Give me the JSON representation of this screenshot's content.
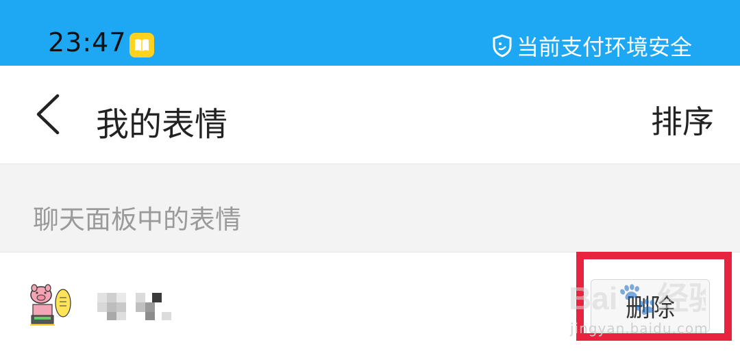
{
  "status_bar": {
    "time": "23:47",
    "notification_icon": "book-icon",
    "security_text": "当前支付环境安全",
    "background_color": "#1ea7f2"
  },
  "nav": {
    "back_icon": "chevron-left-icon",
    "title": "我的表情",
    "sort_label": "排序"
  },
  "section": {
    "title": "聊天面板中的表情"
  },
  "items": [
    {
      "name_blurred": true,
      "delete_label": "删除"
    }
  ],
  "watermark": {
    "logo": "Bai🐾经验",
    "url": "jingyan.baidu.com"
  },
  "highlight_color": "#e8233f"
}
